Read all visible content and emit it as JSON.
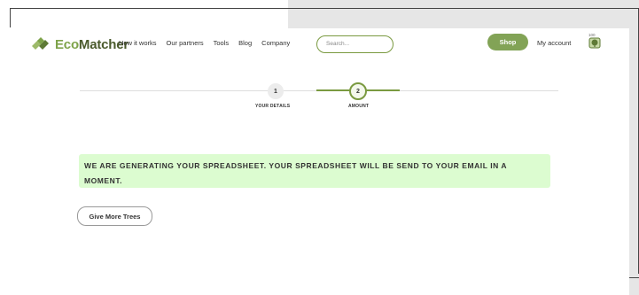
{
  "brand": {
    "name_part1": "Eco",
    "name_part2": "Matcher"
  },
  "nav": {
    "items": [
      "How it works",
      "Our partners",
      "Tools",
      "Blog",
      "Company"
    ]
  },
  "search": {
    "placeholder": "Search..."
  },
  "header": {
    "shop_label": "Shop",
    "account_label": "My account",
    "tree_count": "100"
  },
  "steps": [
    {
      "number": "1",
      "label": "YOUR DETAILS"
    },
    {
      "number": "2",
      "label": "AMOUNT"
    }
  ],
  "message": {
    "text": "WE ARE GENERATING YOUR SPREADSHEET. YOUR SPREADSHEET WILL BE SEND TO YOUR EMAIL IN A MOMENT."
  },
  "actions": {
    "give_more_label": "Give More Trees"
  },
  "colors": {
    "accent": "#82a356",
    "success_bg": "#dcfcd0"
  }
}
